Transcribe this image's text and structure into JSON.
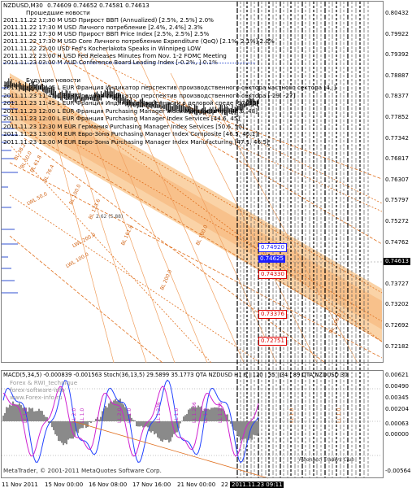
{
  "symbol": {
    "title": "NZDUSD,M30",
    "ohlc": "0.74609 0.74652 0.74581 0.74613"
  },
  "news": {
    "past_header": "Прошедшие новости",
    "future_header": "Будущие новости",
    "past": [
      "2011.11.22 17:30 M USD Прирост ВВП (Annualized) [2.5%, 2.5%] 2.0%",
      "2011.11.22 17:30 M USD Личного потребление [2.4%, 2.4%] 2.3%",
      "2011.11.22 17:30 M USD Прирост ВВП Price Index [2.5%, 2.5%] 2.5%",
      "2011.11.22 17:30 M USD Core Личного потребление Expenditure (QoQ) [2.1%, 2.1%] 2.0%",
      "2011.11.22 22:00   USD Fed's Kocherlakota Speaks in Winnipeg  LOW",
      "2011.11.22 23:00 H USD Fed Releases Minutes from Nov. 1-2 FOMC Meeting",
      "2011.11.23 03:00 M AUD Conference Board Leading Index [-0.2%, ] 0.1%"
    ],
    "future": [
      "2011.11.23 11:45 L EUR Франция Индикатор перспектив производственного сектора частного сектора [4, ]",
      "2011.11.23 11:45 L EUR Франция Индикатор перспектив производственного сектора [-29, -27]",
      "2011.11.23 11:45 L EUR Франция Индикатор уверенности в деловой среде [97, 95]",
      "2011.11.23 12:00 L EUR Франция Purchasing Manager Index Manufacturing [48.5, 48]",
      "2011.11.23 12:00 L EUR Франция Purchasing Manager Index Services [44.6, 45]",
      "2011.11.23 12:30 M EUR Германия Purchasing Manager Index Services [50.6, 50]",
      "2011.11.23 13:00 M EUR Евро-Зона Purchasing Manager Index Composite [46.5, 46.1]",
      "2011.11.23 13:00 M EUR Евро-Зона Purchasing Manager Index Manufacturing [47.1, 46.5]"
    ]
  },
  "price_scale": [
    "0.80432",
    "0.79922",
    "0.79392",
    "0.78887",
    "0.78377",
    "0.77852",
    "0.77342",
    "0.76817",
    "0.76307",
    "0.75797",
    "0.75272",
    "0.74762",
    "0.74237",
    "0.73727",
    "0.73202",
    "0.72692",
    "0.72182"
  ],
  "price_labels": {
    "current": "0.74613",
    "blue_top": "0.74920",
    "blue_mid": "0.74625",
    "red_a": "0.74330",
    "red_b": "0.73376",
    "red_c": "0.72751"
  },
  "fib_labels": [
    "BL 38.2",
    "BL 50.0",
    "BL 61.8",
    "BL 76.4",
    "BL 100.0",
    "BL 123.6",
    "BL 161.8",
    "BL 200.0",
    "LWL 50.0",
    "LWL 100.0",
    "LWL 200.0",
    "2.62 (5.88)",
    "BL 100.0",
    "BL 100.0"
  ],
  "indicator": {
    "header": "MACD(5,34,5) -0.000839 -0.001563  Stoch(36,13,5) 29.5899 35.1773  QTA NZDUSD H1  6 | 120 | 35 | 34 | 89  QTA NZDUSD 30",
    "watermark_lines": [
      "Forex & RWI_technique",
      "forex-software-info",
      "www.Forex-info.ru"
    ],
    "scale": [
      "0.00621",
      "0.00490",
      "0.00345",
      "0.00204",
      "0.00063",
      "0.00000",
      "-0.00564"
    ],
    "ll_labels": [
      "LL 1.0",
      "LL 2.0",
      "LL 1.0",
      "LL 2.0",
      "LL 1.0",
      "LL 1.236",
      "LL 1.0",
      "LL 1.236",
      "LL 1.0",
      "LL 1.236",
      "LL 1.0",
      "LL 1.0"
    ],
    "club": "Fibonacci Traders Club"
  },
  "footer": {
    "copyright": "MetaTrader, © 2001-2011 MetaQuotes Software Corp."
  },
  "time_labels": [
    "11 Nov 2011",
    "15 Nov 00:00",
    "16 Nov 08:00",
    "17 Nov 16:00",
    "21 Nov 00:00",
    "22",
    "2011.11.23 09:11"
  ],
  "colors": {
    "background": "#ffffff",
    "candles": "#000000",
    "channel_fill": "#f8c48a",
    "fib_lines": "#e0701e",
    "news_lines": "#000000",
    "blue_box": "#1e1eff",
    "red_box": "#e00000",
    "current_box": "#000000",
    "macd_fill": "#808080",
    "stoch_main": "#2040ff",
    "stoch_signal": "#d020d0"
  }
}
